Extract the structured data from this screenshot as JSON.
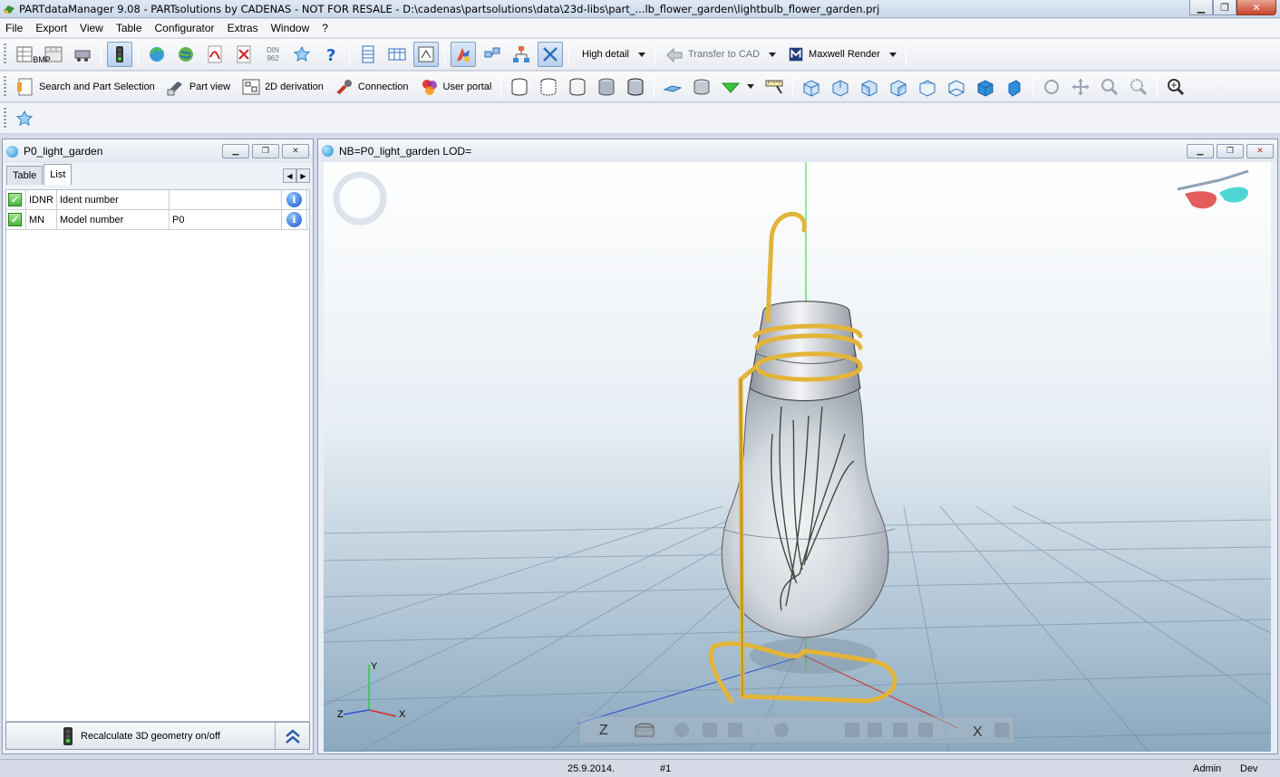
{
  "window": {
    "title": "PARTdataManager 9.08 - PARTsolutions by CADENAS - NOT FOR RESALE - D:\\cadenas\\partsolutions\\data\\23d-libs\\part_...lb_flower_garden\\lightbulb_flower_garden.prj"
  },
  "menu": [
    "File",
    "Export",
    "View",
    "Table",
    "Configurator",
    "Extras",
    "Window",
    "?"
  ],
  "toolbar1": {
    "bmp_label": "BMP",
    "din_label": "DIN 962",
    "detail_level": "High detail",
    "transfer_label": "Transfer to CAD",
    "render_label": "Maxwell Render"
  },
  "toolbar2": {
    "search_label": "Search and Part Selection",
    "partview_label": "Part view",
    "derivation_label": "2D derivation",
    "connection_label": "Connection",
    "portal_label": "User portal"
  },
  "left_panel": {
    "title": "P0_light_garden",
    "tabs": [
      "Table",
      "List"
    ],
    "active_tab": "List",
    "rows": [
      {
        "key": "IDNR",
        "desc": "Ident number",
        "value": ""
      },
      {
        "key": "MN",
        "desc": "Model number",
        "value": "P0"
      }
    ],
    "bottom_label": "Recalculate 3D geometry on/off"
  },
  "viewer": {
    "title": "NB=P0_light_garden LOD=",
    "axis_y": "Y",
    "axis_x": "X",
    "axis_z": "Z",
    "floor_z": "Z",
    "floor_x": "X"
  },
  "status": {
    "date": "25.9.2014.",
    "number": "#1",
    "user": "Admin",
    "mode": "Dev"
  },
  "colors": {
    "accent": "#1a8fd6",
    "wire": "#e3b43a",
    "sky_top": "#ffffff",
    "floor": "#9fb8cb"
  }
}
